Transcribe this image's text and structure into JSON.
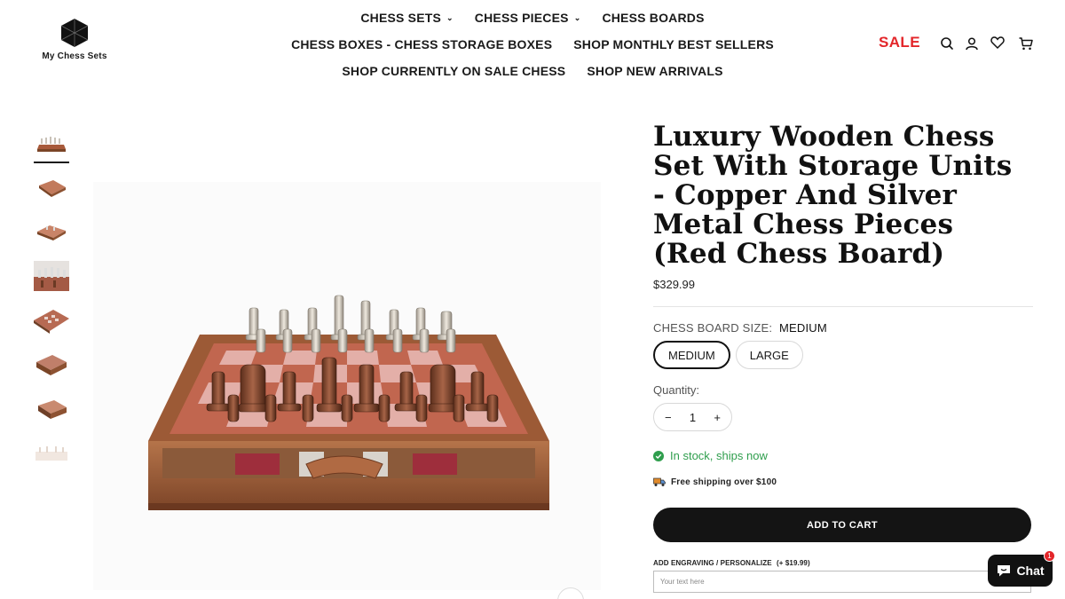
{
  "store": {
    "name": "My Chess Sets"
  },
  "nav": {
    "row1": [
      {
        "label": "CHESS SETS",
        "has_dropdown": true
      },
      {
        "label": "CHESS PIECES",
        "has_dropdown": true
      },
      {
        "label": "CHESS BOARDS",
        "has_dropdown": false
      }
    ],
    "row2": [
      {
        "label": "CHESS BOXES - CHESS STORAGE BOXES"
      },
      {
        "label": "SHOP MONTHLY BEST SELLERS"
      }
    ],
    "row3": [
      {
        "label": "SHOP CURRENTLY ON SALE CHESS"
      },
      {
        "label": "SHOP NEW ARRIVALS"
      }
    ],
    "sale_label": "SALE",
    "sale_color": "#e3262a",
    "icons": [
      "search-icon",
      "account-icon",
      "wishlist-heart-icon",
      "cart-icon"
    ]
  },
  "gallery": {
    "thumbnail_count": 8,
    "active_thumbnail": 1
  },
  "product": {
    "title": "Luxury Wooden Chess Set With Storage Units - Copper And Silver Metal Chess Pieces (Red Chess Board)",
    "price": "$329.99",
    "option_label": "CHESS BOARD SIZE:",
    "option_value": "MEDIUM",
    "sizes": [
      "MEDIUM",
      "LARGE"
    ],
    "quantity_label": "Quantity:",
    "quantity": "1",
    "qty_minus": "−",
    "qty_plus": "+",
    "stock_text": "In stock, ships now",
    "stock_color": "#2f9e4d",
    "shipping_text": "Free shipping over $100",
    "add_to_cart": "ADD TO CART",
    "engraving_label": "ADD ENGRAVING / PERSONALIZE",
    "engraving_fee": "(+ $19.99)",
    "engraving_placeholder": "Your text here"
  },
  "chat": {
    "label": "Chat",
    "badge": "1"
  }
}
